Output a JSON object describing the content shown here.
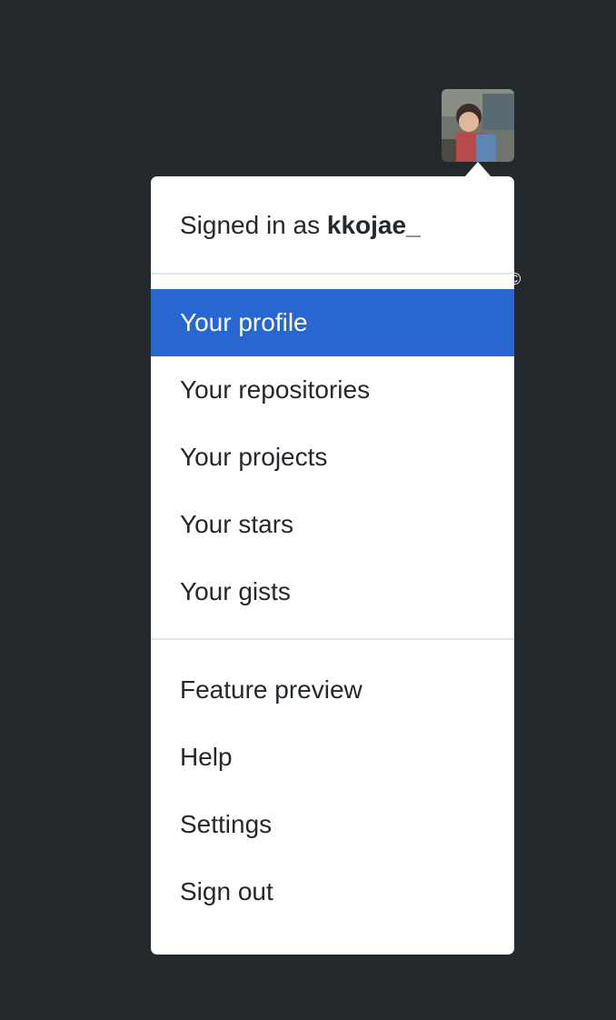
{
  "avatar": {
    "icon": "user-avatar-photo"
  },
  "header": {
    "signed_in_prefix": "Signed in as",
    "username": "kkojae_"
  },
  "menu": {
    "group1": [
      {
        "label": "Your profile",
        "active": true
      },
      {
        "label": "Your repositories"
      },
      {
        "label": "Your projects"
      },
      {
        "label": "Your stars"
      },
      {
        "label": "Your gists"
      }
    ],
    "group2": [
      {
        "label": "Feature preview"
      },
      {
        "label": "Help"
      },
      {
        "label": "Settings"
      },
      {
        "label": "Sign out"
      }
    ]
  },
  "overlay_mark": "©",
  "colors": {
    "background": "#24292e",
    "active": "#2867d2",
    "text": "#24292e"
  }
}
